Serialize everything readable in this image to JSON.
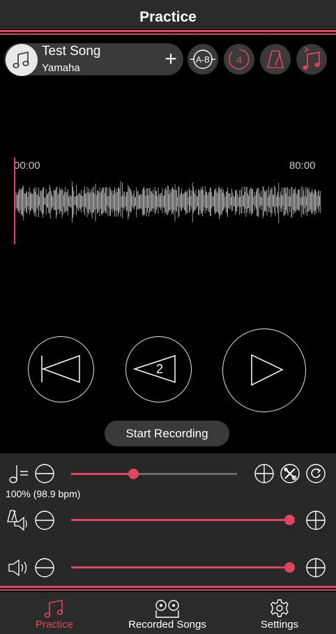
{
  "header": {
    "title": "Practice"
  },
  "song": {
    "title": "Test Song",
    "artist": "Yamaha"
  },
  "toolbar": {
    "ab_label": "A-B",
    "count_in": "4"
  },
  "waveform": {
    "start_time": "00:00",
    "end_time": "80:00"
  },
  "transport": {
    "skip_back_count": "2",
    "start_recording_label": "Start Recording"
  },
  "controls": {
    "tempo_value": "100% (98.9 bpm)",
    "tempo_level": 0.33,
    "guide_volume_level": 1.0,
    "volume_level": 1.0
  },
  "nav": {
    "practice": "Practice",
    "recorded_songs": "Recorded Songs",
    "settings": "Settings"
  },
  "colors": {
    "accent": "#e0445f",
    "panel": "#282828",
    "surface": "#3a3a3a"
  }
}
